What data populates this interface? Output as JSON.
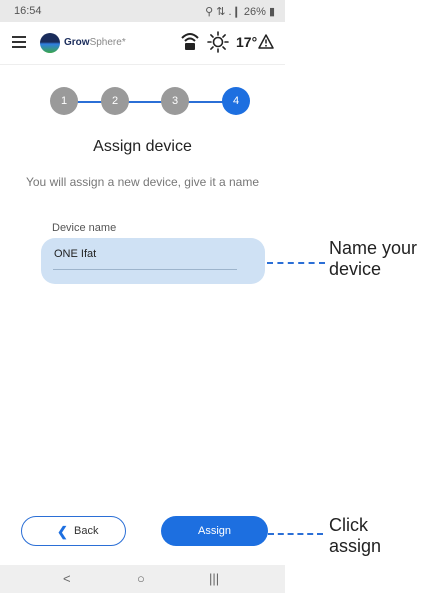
{
  "status_bar": {
    "time": "16:54",
    "indicators": "⚲ ⇅ .❙ 26% ▮"
  },
  "app_bar": {
    "brand_bold": "Grow",
    "brand_light": "Sphere",
    "brand_mark": "*",
    "temperature": "17°",
    "icons": [
      "hamburger-menu-icon",
      "growsphere-logo",
      "wifi-signal-icon",
      "sun-icon",
      "warning-icon"
    ]
  },
  "stepper": {
    "steps": [
      "1",
      "2",
      "3",
      "4"
    ],
    "active_step": 4,
    "colors": {
      "inactive": "#9a9a9a",
      "active": "#1d6fe0",
      "line": "#2b6fd6"
    }
  },
  "page": {
    "title": "Assign device",
    "subtitle": "You will assign a new device, give it a name"
  },
  "form": {
    "device_name_label": "Device name",
    "device_name_value": "ONE Ifat"
  },
  "actions": {
    "back_label": "Back",
    "assign_label": "Assign"
  },
  "system_nav": {
    "back": "<",
    "home": "○",
    "recents": "|||"
  },
  "annotations": {
    "name_line1": "Name your",
    "name_line2": "device",
    "assign_line1": "Click",
    "assign_line2": "assign"
  }
}
